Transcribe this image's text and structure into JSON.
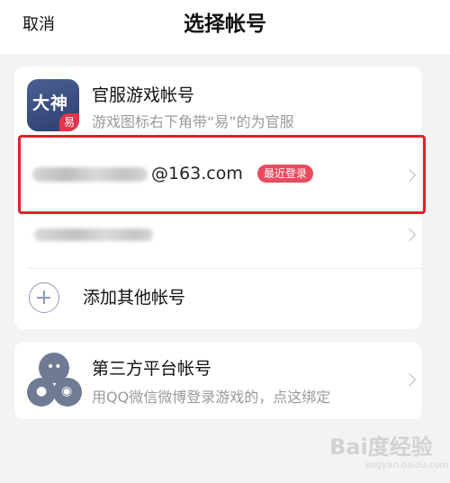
{
  "header": {
    "cancel_label": "取消",
    "title": "选择帐号"
  },
  "official_section": {
    "title": "官服游戏帐号",
    "subtitle": "游戏图标右下角带“易”的为官服",
    "icon_text": "大神",
    "icon_badge": "易"
  },
  "accounts": [
    {
      "email_suffix": "@163.com",
      "badge": "最近登录",
      "selected": true
    },
    {
      "email_suffix": "",
      "badge": "",
      "selected": false
    }
  ],
  "add_account": {
    "label": "添加其他帐号"
  },
  "third_party": {
    "title": "第三方平台帐号",
    "subtitle": "用QQ微信微博登录游戏的，点这绑定"
  },
  "watermark": {
    "text": "Bai度经验",
    "sub": "jingyan.baidu.com"
  },
  "colors": {
    "accent_red": "#e0202e",
    "badge_red": "#ea4b5e",
    "background": "#f2f3f5"
  }
}
